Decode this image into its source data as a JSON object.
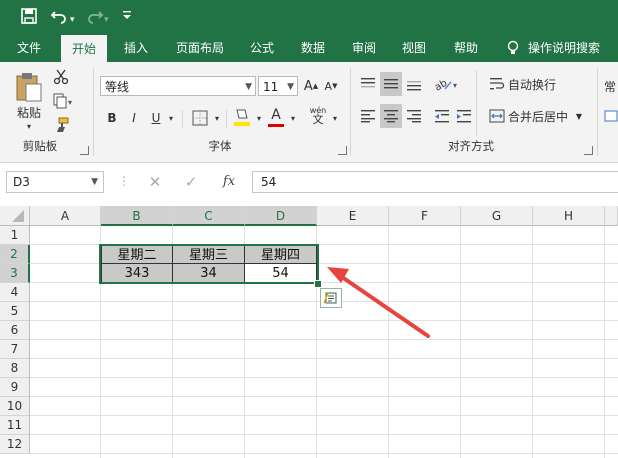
{
  "quick_access": {
    "save_icon": "save-icon",
    "undo_icon": "undo-icon",
    "redo_icon": "redo-icon",
    "customize_icon": "customize-qat-icon"
  },
  "tabs": [
    "文件",
    "开始",
    "插入",
    "页面布局",
    "公式",
    "数据",
    "审阅",
    "视图",
    "帮助"
  ],
  "active_tab": "开始",
  "tell_me": "操作说明搜索",
  "ribbon": {
    "clipboard": {
      "paste_label": "粘贴",
      "group_label": "剪贴板"
    },
    "font": {
      "font_name": "等线",
      "font_size": "11",
      "bold": "B",
      "italic": "I",
      "underline": "U",
      "font_color_glyph": "A",
      "wen_glyph": "wén",
      "group_label": "字体",
      "grow": "A",
      "shrink": "A"
    },
    "alignment": {
      "wrap_text": "自动换行",
      "merge_center": "合并后居中",
      "group_label": "对齐方式"
    },
    "number": {
      "partial_label": "常"
    }
  },
  "formula_bar": {
    "name_box": "D3",
    "fx_label": "fx",
    "value": "54"
  },
  "sheet": {
    "columns": [
      "A",
      "B",
      "C",
      "D",
      "E",
      "F",
      "G",
      "H"
    ],
    "rows": [
      "1",
      "2",
      "3",
      "4",
      "5",
      "6",
      "7",
      "8",
      "9",
      "10",
      "11",
      "12"
    ],
    "cells": {
      "B2": "星期二",
      "C2": "星期三",
      "D2": "星期四",
      "B3": "343",
      "C3": "34",
      "D3": "54"
    }
  },
  "colors": {
    "accent": "#217346",
    "arrow": "#e8433f",
    "cell_fill": "#c9c9c9",
    "font_red": "#e00000",
    "highlight_yellow": "#ffe600"
  }
}
